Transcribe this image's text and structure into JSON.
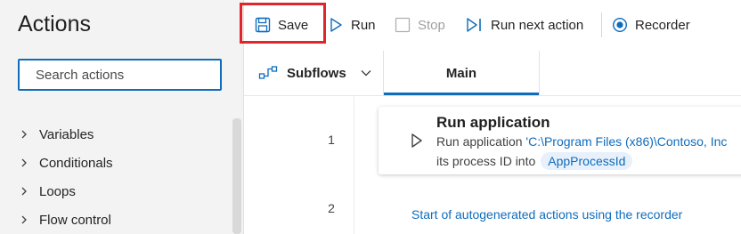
{
  "left_pane": {
    "title": "Actions",
    "search_placeholder": "Search actions",
    "categories": [
      "Variables",
      "Conditionals",
      "Loops",
      "Flow control"
    ]
  },
  "toolbar": {
    "save_label": "Save",
    "run_label": "Run",
    "stop_label": "Stop",
    "run_next_label": "Run next action",
    "recorder_label": "Recorder"
  },
  "tabs": {
    "subflows_label": "Subflows",
    "main_label": "Main"
  },
  "editor": {
    "line_numbers": [
      "1",
      "2"
    ],
    "action": {
      "title": "Run application",
      "desc_prefix": "Run application ",
      "path": "'C:\\Program Files (x86)\\Contoso, Inc",
      "desc_line2": "its process ID into",
      "variable": "AppProcessId"
    },
    "comment": "Start of autogenerated actions using the recorder"
  },
  "colors": {
    "accent": "#0f6cbd",
    "highlight": "#e0262c",
    "pane_bg": "#f3f3f3"
  }
}
